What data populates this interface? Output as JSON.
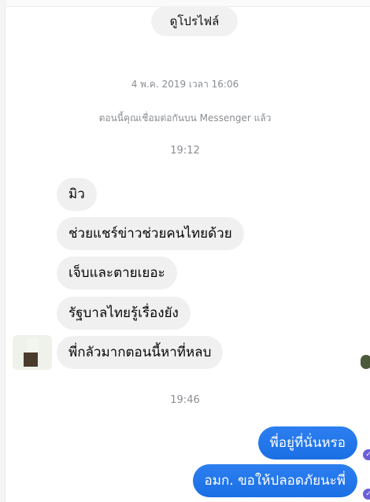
{
  "header": {
    "profile_button": "ดูโปรไฟล์"
  },
  "meta": {
    "date": "4 พ.ค. 2019 เวลา 16:06",
    "connected_notice": "ตอนนี้คุณเชื่อมต่อกันบน Messenger แล้ว",
    "time_1": "19:12",
    "time_2": "19:46"
  },
  "messages": {
    "incoming": [
      "มิว",
      "ช่วยแชร์ข่าวช่วยคนไทยด้วย",
      "เจ็บและตายเยอะ",
      "รัฐบาลไทยรู้เรื่องยัง",
      "พี่กลัวมากตอนนี้หาที่หลบ"
    ],
    "outgoing": [
      "พี่อยู่ที่นั่นหรอ",
      "อมก. ขอให้ปลอดภัยนะพี่"
    ]
  },
  "status": {
    "delivered_glyph": "✓"
  },
  "colors": {
    "incoming_bubble": "#f0f0f0",
    "outgoing_bubble": "#1b74e8",
    "meta_text": "#8a8d91"
  }
}
